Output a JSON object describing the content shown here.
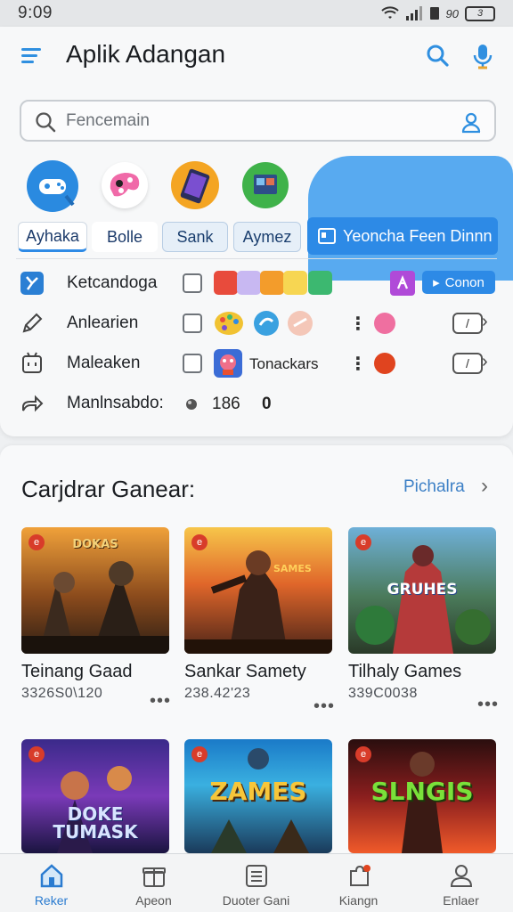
{
  "status_bar": {
    "time": "9:09",
    "extra": "90",
    "battery": "3"
  },
  "header": {
    "title": "Aplik Adangan"
  },
  "search": {
    "placeholder": "Fencemain"
  },
  "categories": [
    {
      "label": "Ayhaka",
      "icon": "gamepad-icon"
    },
    {
      "label": "Bolle",
      "icon": "paint-icon"
    },
    {
      "label": "Sank",
      "icon": "phone-icon"
    },
    {
      "label": "Aymez",
      "icon": "screen-icon"
    },
    {
      "label": "Yeoncha Feen Dinnn",
      "icon": "window-icon"
    }
  ],
  "options": [
    {
      "label": "Ketcandoga",
      "colors": [
        "#e84b3c",
        "#c8b8f2",
        "#f39c2b",
        "#f7d652",
        "#3cb870"
      ],
      "action": "Conon",
      "action_color": "#2d8ae6",
      "badge_color": "#b04ad8"
    },
    {
      "label": "Anlearien",
      "dot_color": "#ef6fa0",
      "toggle": "/"
    },
    {
      "label": "Maleaken",
      "image_label": "Tonackars",
      "dot_color": "#e0441f",
      "toggle": "/"
    },
    {
      "label": "Manlnsabdo:",
      "value": "186",
      "extra": "0"
    }
  ],
  "section": {
    "title": "Carjdrar Ganear:",
    "see_all": "Pichalra"
  },
  "games": [
    {
      "name": "Teinang Gaad",
      "meta": "3326S0\\120",
      "logo": "DOKAS"
    },
    {
      "name": "Sankar Samety",
      "meta": "238.42'23",
      "logo": "SAMES"
    },
    {
      "name": "Tilhaly Games",
      "meta": "339C0038",
      "logo": "GRUHES"
    },
    {
      "name": "",
      "meta": "",
      "logo": "DOKE TUMASK"
    },
    {
      "name": "",
      "meta": "",
      "logo": "ZAMES"
    },
    {
      "name": "",
      "meta": "",
      "logo": "SLNGIS"
    }
  ],
  "bottom_nav": [
    {
      "label": "Reker",
      "icon": "home-icon",
      "active": true
    },
    {
      "label": "Apeon",
      "icon": "gift-icon",
      "active": false
    },
    {
      "label": "Duoter Gani",
      "icon": "list-icon",
      "active": false
    },
    {
      "label": "Kiangn",
      "icon": "puzzle-icon",
      "active": false
    },
    {
      "label": "Enlaer",
      "icon": "user-icon",
      "active": false
    }
  ]
}
